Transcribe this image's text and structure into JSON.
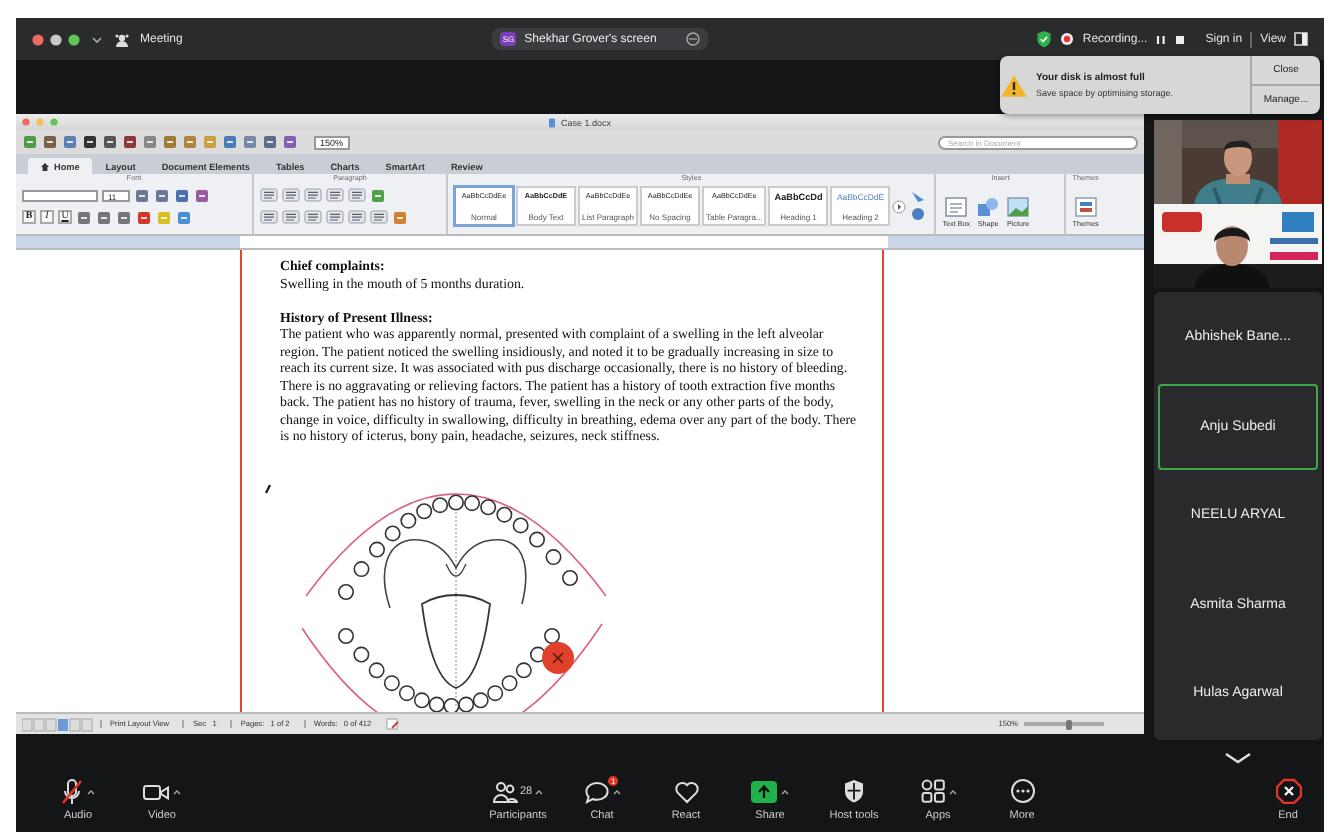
{
  "meeting_bar": {
    "title": "Meeting",
    "share_pill": {
      "initials": "SG",
      "label": "Shekhar Grover's screen"
    },
    "recording": "Recording...",
    "sign_in": "Sign in",
    "view": "View"
  },
  "notification": {
    "title": "Your disk is almost full",
    "message": "Save space by optimising storage.",
    "buttons": [
      "Close",
      "Manage..."
    ]
  },
  "word": {
    "title": "Case 1.docx",
    "zoom": "150%",
    "search": {
      "placeholder": "Search in Document"
    },
    "tabs": [
      {
        "label": "Home",
        "selected": true
      },
      {
        "label": "Layout",
        "selected": false
      },
      {
        "label": "Document Elements",
        "selected": false
      },
      {
        "label": "Tables",
        "selected": false
      },
      {
        "label": "Charts",
        "selected": false
      },
      {
        "label": "SmartArt",
        "selected": false
      },
      {
        "label": "Review",
        "selected": false
      }
    ],
    "groups": [
      "Font",
      "Paragraph",
      "Styles",
      "Insert",
      "Themes"
    ],
    "font_size": "11",
    "format_buttons": [
      "B",
      "I",
      "U"
    ],
    "styles": [
      {
        "preview": "AaBbCcDdEe",
        "name": "Normal",
        "kind": "normal",
        "selected": true
      },
      {
        "preview": "AaBbCcDdE",
        "name": "Body Text",
        "kind": "body",
        "selected": false
      },
      {
        "preview": "AaBbCcDdEe",
        "name": "List Paragraph",
        "kind": "normal",
        "selected": false
      },
      {
        "preview": "AaBbCcDdEe",
        "name": "No Spacing",
        "kind": "normal",
        "selected": false
      },
      {
        "preview": "AaBbCcDdEe",
        "name": "Table Paragra...",
        "kind": "normal",
        "selected": false
      },
      {
        "preview": "AaBbCcDd",
        "name": "Heading 1",
        "kind": "heading1",
        "selected": false
      },
      {
        "preview": "AaBbCcDdE",
        "name": "Heading 2",
        "kind": "heading2",
        "selected": false
      }
    ],
    "insert": [
      "Text Box",
      "Shape",
      "Picture"
    ],
    "themes": "Themes",
    "document": {
      "heading_1": "Chief complaints:",
      "text_1": "Swelling in the mouth of 5 months duration.",
      "heading_2": "History of Present Illness:",
      "paragraph": "The patient who was apparently normal, presented with complaint of a swelling in the left alveolar region. The patient noticed the swelling insidiously, and noted it to be gradually increasing in size to reach  its current size. It was associated with pus discharge occasionally, there is no history of bleeding. There is no aggravating or relieving factors. The patient has a history of tooth extraction five months back. The patient has no history of trauma, fever, swelling in the neck or any other parts of the body, change in voice, difficulty in swallowing, difficulty in breathing, edema over any part of the body. There is no history of icterus, bony pain, headache, seizures, neck stiffness."
    },
    "status_bar": [
      "Print Layout View",
      "Sec   1",
      "Pages:   1 of 2",
      "Words:   0 of 412"
    ],
    "status_zoom": "150%",
    "zoom_slider": {
      "level": 0.55
    }
  },
  "participants": [
    {
      "name": "Abhishek Bane...",
      "speaking": false
    },
    {
      "name": "Anju Subedi",
      "speaking": true
    },
    {
      "name": "NEELU ARYAL",
      "speaking": false
    },
    {
      "name": "Asmita Sharma",
      "speaking": false
    },
    {
      "name": "Hulas Agarwal",
      "speaking": false
    }
  ],
  "toolbar": [
    {
      "label": "Audio",
      "kind": "audio",
      "muted": true,
      "menu": true
    },
    {
      "label": "Video",
      "kind": "video",
      "menu": true
    },
    {
      "label": "Participants",
      "kind": "participants",
      "count": "28",
      "menu": true
    },
    {
      "label": "Chat",
      "kind": "chat",
      "badge": "1",
      "menu": true
    },
    {
      "label": "React",
      "kind": "react",
      "menu": false
    },
    {
      "label": "Share",
      "kind": "share",
      "menu": true
    },
    {
      "label": "Host tools",
      "kind": "host",
      "menu": false
    },
    {
      "label": "Apps",
      "kind": "apps",
      "menu": true
    },
    {
      "label": "More",
      "kind": "more",
      "menu": false
    },
    {
      "label": "End",
      "kind": "end",
      "menu": false
    }
  ]
}
